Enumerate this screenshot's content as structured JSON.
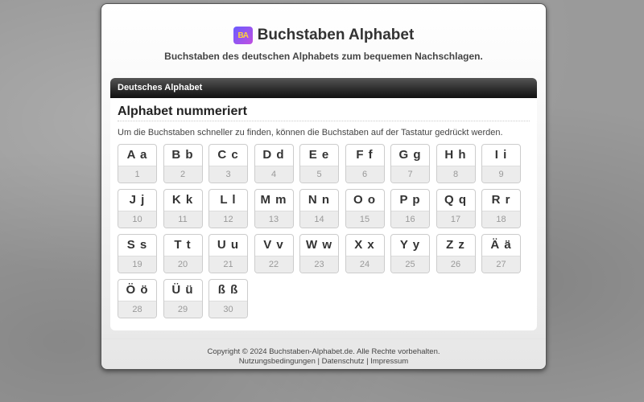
{
  "header": {
    "logo_text": "BA",
    "title": "Buchstaben Alphabet",
    "subtitle": "Buchstaben des deutschen Alphabets zum bequemen Nachschlagen."
  },
  "panel": {
    "heading": "Deutsches Alphabet",
    "section_title": "Alphabet nummeriert",
    "description": "Um die Buchstaben schneller zu finden, können die Buchstaben auf der Tastatur gedrückt werden."
  },
  "letters": [
    {
      "letter": "A a",
      "number": "1"
    },
    {
      "letter": "B b",
      "number": "2"
    },
    {
      "letter": "C c",
      "number": "3"
    },
    {
      "letter": "D d",
      "number": "4"
    },
    {
      "letter": "E e",
      "number": "5"
    },
    {
      "letter": "F f",
      "number": "6"
    },
    {
      "letter": "G g",
      "number": "7"
    },
    {
      "letter": "H h",
      "number": "8"
    },
    {
      "letter": "I i",
      "number": "9"
    },
    {
      "letter": "J j",
      "number": "10"
    },
    {
      "letter": "K k",
      "number": "11"
    },
    {
      "letter": "L l",
      "number": "12"
    },
    {
      "letter": "M m",
      "number": "13"
    },
    {
      "letter": "N n",
      "number": "14"
    },
    {
      "letter": "O o",
      "number": "15"
    },
    {
      "letter": "P p",
      "number": "16"
    },
    {
      "letter": "Q q",
      "number": "17"
    },
    {
      "letter": "R r",
      "number": "18"
    },
    {
      "letter": "S s",
      "number": "19"
    },
    {
      "letter": "T t",
      "number": "20"
    },
    {
      "letter": "U u",
      "number": "21"
    },
    {
      "letter": "V v",
      "number": "22"
    },
    {
      "letter": "W w",
      "number": "23"
    },
    {
      "letter": "X x",
      "number": "24"
    },
    {
      "letter": "Y y",
      "number": "25"
    },
    {
      "letter": "Z z",
      "number": "26"
    },
    {
      "letter": "Ä ä",
      "number": "27"
    },
    {
      "letter": "Ö ö",
      "number": "28"
    },
    {
      "letter": "Ü ü",
      "number": "29"
    },
    {
      "letter": "ß ß",
      "number": "30"
    }
  ],
  "footer": {
    "copyright": "Copyright © 2024 Buchstaben-Alphabet.de. Alle Rechte vorbehalten.",
    "link_terms": "Nutzungsbedingungen",
    "link_privacy": "Datenschutz",
    "link_imprint": "Impressum",
    "separator": "|"
  }
}
